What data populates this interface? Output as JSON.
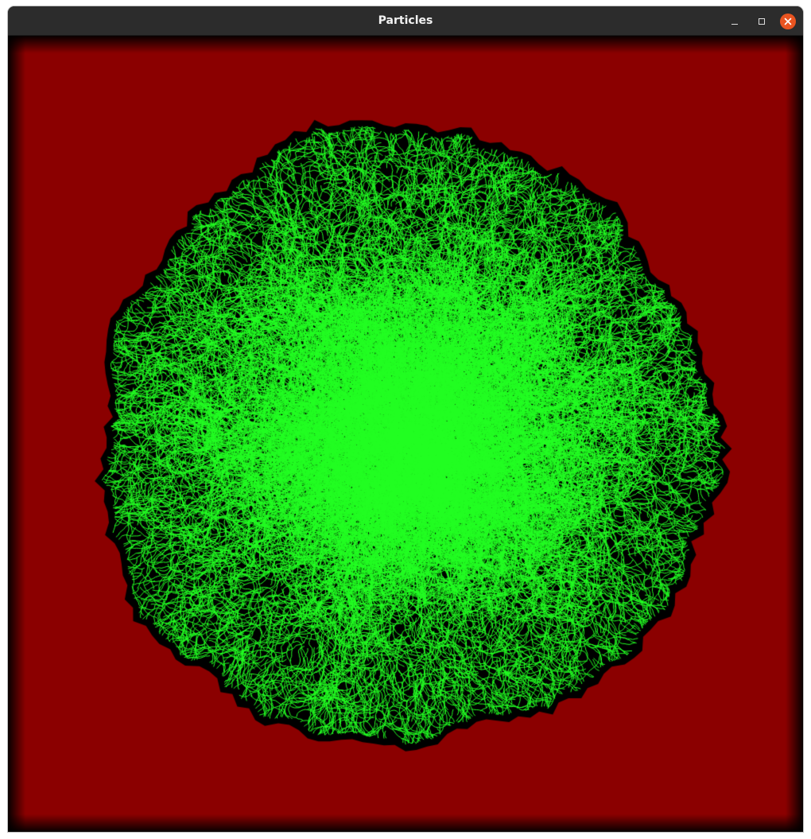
{
  "window": {
    "title": "Particles",
    "controls": {
      "minimize_icon": "minimize-icon",
      "maximize_icon": "maximize-icon",
      "close_icon": "close-icon",
      "close_color": "#e95420"
    }
  },
  "simulation": {
    "background_color": "#8b0000",
    "cluster_halo_color": "#000000",
    "particle_color": "#22ff22"
  }
}
